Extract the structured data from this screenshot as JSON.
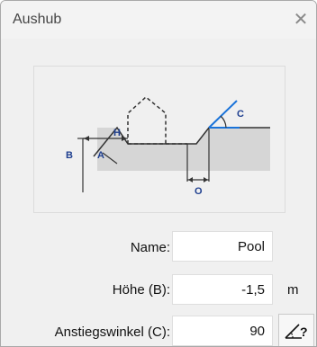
{
  "window": {
    "title": "Aushub",
    "close_glyph": "✕"
  },
  "diagram": {
    "label_a": "A",
    "label_b": "B",
    "label_c": "C",
    "label_h": "H",
    "label_o": "O",
    "accent_color": "#1a73d9",
    "label_color": "#1f3f8f"
  },
  "form": {
    "name_label": "Name:",
    "name_value": "Pool",
    "height_label": "Höhe (B):",
    "height_value": "-1,5",
    "height_unit": "m",
    "angle_label": "Anstiegswinkel (C):",
    "angle_value": "90",
    "angle_button_icon": "angle-question-icon",
    "angle_button_glyph": "?"
  }
}
